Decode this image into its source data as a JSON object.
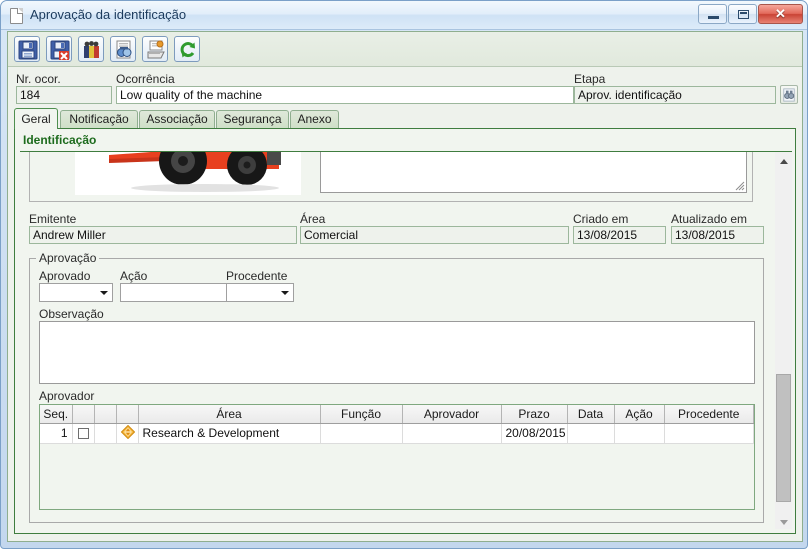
{
  "window": {
    "title": "Aprovação da identificação",
    "title_icon": "document-icon",
    "minimize_label": "",
    "maximize_label": "",
    "close_label": "✕"
  },
  "toolbar": {
    "buttons": [
      {
        "name": "save-button",
        "icon": "save-icon",
        "tooltip": "Salvar"
      },
      {
        "name": "save-and-close-button",
        "icon": "save-close-icon",
        "tooltip": "Salvar e fechar"
      },
      {
        "name": "attachments-button",
        "icon": "attachments-icon",
        "tooltip": "Anexos"
      },
      {
        "name": "search-document-button",
        "icon": "search-document-icon",
        "tooltip": "Pesquisar"
      },
      {
        "name": "print-button",
        "icon": "print-icon",
        "tooltip": "Imprimir"
      },
      {
        "name": "refresh-button",
        "icon": "refresh-icon",
        "tooltip": "Atualizar"
      }
    ]
  },
  "header": {
    "nr_ocor_label": "Nr. ocor.",
    "nr_ocor_value": "184",
    "ocorrencia_label": "Ocorrência",
    "ocorrencia_value": "Low quality of the machine",
    "etapa_label": "Etapa",
    "etapa_value": "Aprov. identificação",
    "etapa_button_icon": "binoculars-icon"
  },
  "tabs": [
    {
      "label": "Geral",
      "active": true
    },
    {
      "label": "Notificação",
      "active": false
    },
    {
      "label": "Associação",
      "active": false
    },
    {
      "label": "Segurança",
      "active": false
    },
    {
      "label": "Anexo",
      "active": false
    }
  ],
  "section": {
    "title": "Identificação",
    "picture_alt": "forklift-photo",
    "description_value": ""
  },
  "fields": {
    "emitente_label": "Emitente",
    "emitente_value": "Andrew Miller",
    "area_label": "Área",
    "area_value": "Comercial",
    "criado_em_label": "Criado em",
    "criado_em_value": "13/08/2015",
    "atualizado_em_label": "Atualizado em",
    "atualizado_em_value": "13/08/2015"
  },
  "aprovacao": {
    "group_title": "Aprovação",
    "aprovado_label": "Aprovado",
    "aprovado_value": "",
    "acao_label": "Ação",
    "acao_value": "",
    "procedente_label": "Procedente",
    "procedente_value": "",
    "observacao_label": "Observação",
    "observacao_value": ""
  },
  "aprovador": {
    "group_title": "Aprovador",
    "columns": [
      "Seq.",
      "",
      "",
      "",
      "Área",
      "Função",
      "Aprovador",
      "Prazo",
      "Data",
      "Ação",
      "Procedente"
    ],
    "rows": [
      {
        "seq": "1",
        "checkbox": false,
        "status_icon": "orange-diamond-icon",
        "area": "Research & Development",
        "funcao": "",
        "aprovador": "",
        "prazo": "20/08/2015",
        "data": "",
        "acao": "",
        "procedente": ""
      }
    ]
  },
  "scrollbar": {
    "up_arrow": "chevron-up-icon",
    "down_arrow": "chevron-down-icon"
  },
  "colors": {
    "accent_green": "#1d6b1d",
    "border_green": "#3f7d3f",
    "form_bg": "#eef2ec",
    "page_bg": "#f1f5ef",
    "title_blue": "#1b3a5c",
    "close_red": "#c94335",
    "status_orange": "#f0a315"
  }
}
